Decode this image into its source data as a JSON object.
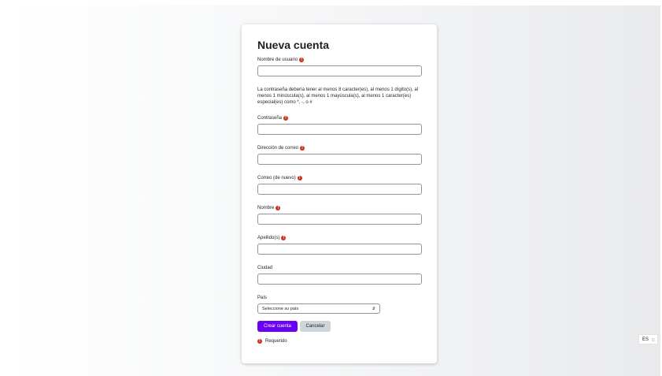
{
  "form": {
    "title": "Nueva cuenta",
    "username_label": "Nombre de usuario",
    "password_policy": "La contraseña debería tener al menos 8 caracter(es), al menos 1 dígito(s), al menos 1 minúscula(s), al menos 1 mayúscula(s), al menos 1 caracter(es) especial(es) como *, -, o #",
    "password_label": "Contraseña",
    "email_label": "Dirección de correo",
    "email_again_label": "Correo (de nuevo)",
    "firstname_label": "Nombre",
    "lastname_label": "Apellido(s)",
    "city_label": "Ciudad",
    "country_label": "País",
    "country_selected": "Seleccione su país",
    "submit_label": "Crear cuenta",
    "cancel_label": "Cancelar",
    "required_note": "Requerido",
    "required_symbol": "!"
  },
  "language": {
    "code": "ES"
  },
  "colors": {
    "primary": "#6a00f4",
    "required": "#ca3120",
    "secondary_button": "#ced4da"
  }
}
